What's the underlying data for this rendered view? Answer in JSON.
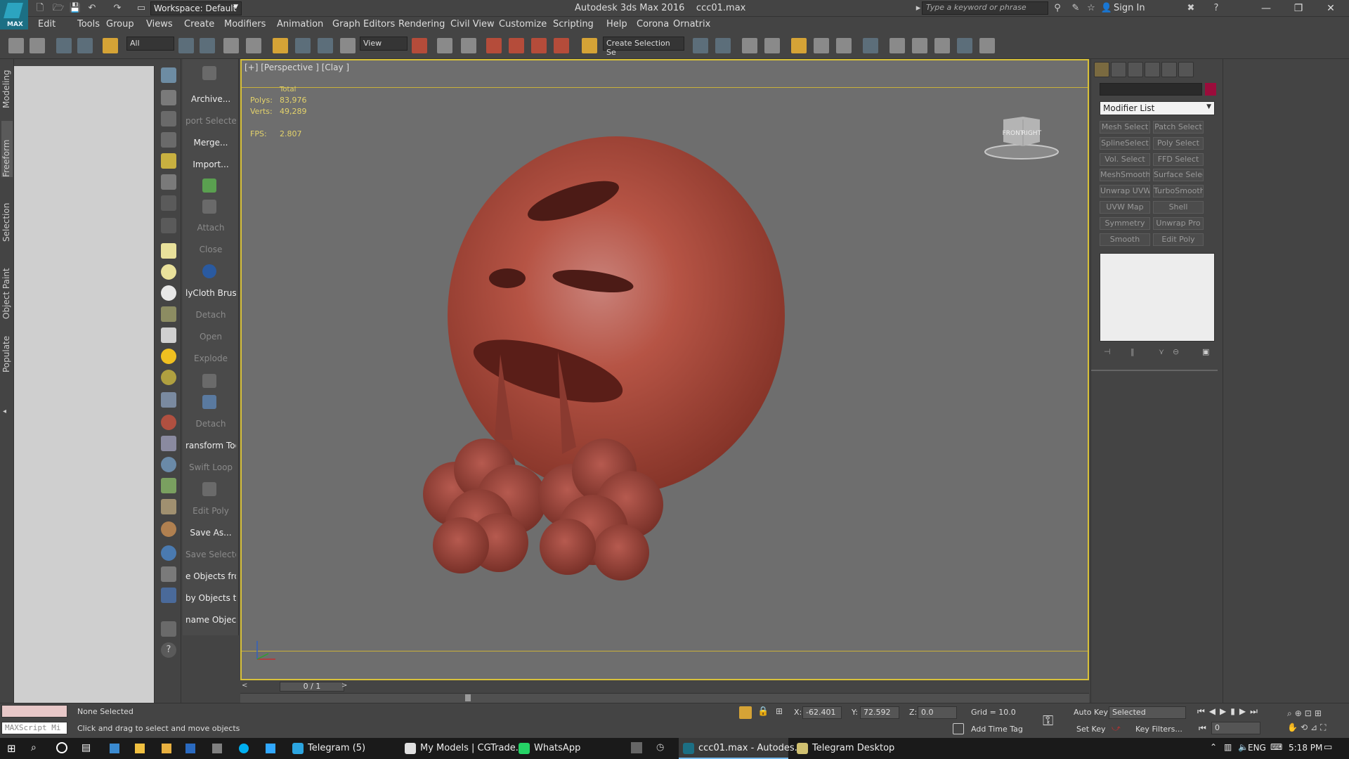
{
  "title_bar": {
    "workspace": "Workspace: Default",
    "app_title": "Autodesk 3ds Max 2016",
    "file_name": "ccc01.max",
    "search_placeholder": "Type a keyword or phrase",
    "sign_in": "Sign In",
    "logo_text": "MAX"
  },
  "menu": [
    "Edit",
    "Tools",
    "Group",
    "Views",
    "Create",
    "Modifiers",
    "Animation",
    "Graph Editors",
    "Rendering",
    "Civil View",
    "Customize",
    "Scripting",
    "Help",
    "Corona",
    "Ornatrix"
  ],
  "toolbar": {
    "filter": "All",
    "ref_coord": "View",
    "selection_set": "Create Selection Se"
  },
  "left_tabs": [
    "Modeling",
    "Freeform",
    "Selection",
    "Object Paint",
    "Populate"
  ],
  "script_panel": [
    {
      "label": "Archive...",
      "enabled": true
    },
    {
      "label": "port Selected",
      "enabled": false
    },
    {
      "label": "Merge...",
      "enabled": true
    },
    {
      "label": "Import...",
      "enabled": true
    },
    {
      "label": "Attach",
      "enabled": false
    },
    {
      "label": "Close",
      "enabled": false
    },
    {
      "label": "lyCloth Brush",
      "enabled": true
    },
    {
      "label": "Detach",
      "enabled": false
    },
    {
      "label": "Open",
      "enabled": false
    },
    {
      "label": "Explode",
      "enabled": false
    },
    {
      "label": "Detach",
      "enabled": false
    },
    {
      "label": "ransform Tool",
      "enabled": true
    },
    {
      "label": "Swift Loop",
      "enabled": false
    },
    {
      "label": "Edit Poly",
      "enabled": false
    },
    {
      "label": "Save As...",
      "enabled": true
    },
    {
      "label": "Save Selected",
      "enabled": false
    },
    {
      "label": "e Objects fron",
      "enabled": true
    },
    {
      "label": "by Objects to",
      "enabled": true
    },
    {
      "label": "name Objects",
      "enabled": true
    }
  ],
  "viewport": {
    "label": "[+] [Perspective ] [Clay ]",
    "stats_header": "Total",
    "polys_label": "Polys:",
    "polys_value": "83,976",
    "verts_label": "Verts:",
    "verts_value": "49,289",
    "fps_label": "FPS:",
    "fps_value": "2.807",
    "cube_front": "FRONT",
    "cube_right": "RIGHT"
  },
  "timeline": {
    "frame": "0 / 1"
  },
  "command_panel": {
    "modifier_list": "Modifier List",
    "buttons": [
      [
        "Mesh Select",
        "Patch Select"
      ],
      [
        "SplineSelect",
        "Poly Select"
      ],
      [
        "Vol. Select",
        "FFD Select"
      ],
      [
        "MeshSmooth",
        "Surface Select"
      ],
      [
        "Unwrap UVW",
        "TurboSmooth"
      ],
      [
        "UVW Map",
        "Shell"
      ],
      [
        "Symmetry",
        "Unwrap Pro"
      ],
      [
        "Smooth",
        "Edit Poly"
      ]
    ],
    "color": "#9b0c3b"
  },
  "status": {
    "selection": "None Selected",
    "prompt": "Click and drag to select and move objects",
    "maxscript": "MAXScript Mi",
    "x_label": "X:",
    "x_value": "-62.401",
    "y_label": "Y:",
    "y_value": "72.592",
    "z_label": "Z:",
    "z_value": "0.0",
    "grid": "Grid = 10.0",
    "add_time_tag": "Add Time Tag",
    "auto_key": "Auto Key",
    "set_key": "Set Key",
    "key_mode": "Selected",
    "key_filters": "Key Filters...",
    "current_frame": "0"
  },
  "taskbar": {
    "tasks": [
      {
        "label": "Telegram (5)",
        "active": false
      },
      {
        "label": "My Models | CGTrade...",
        "active": false
      },
      {
        "label": "WhatsApp",
        "active": false
      },
      {
        "label": "ccc01.max - Autodes...",
        "active": true
      },
      {
        "label": "Telegram Desktop",
        "active": false
      }
    ],
    "language": "ENG",
    "time": "5:18 PM"
  }
}
